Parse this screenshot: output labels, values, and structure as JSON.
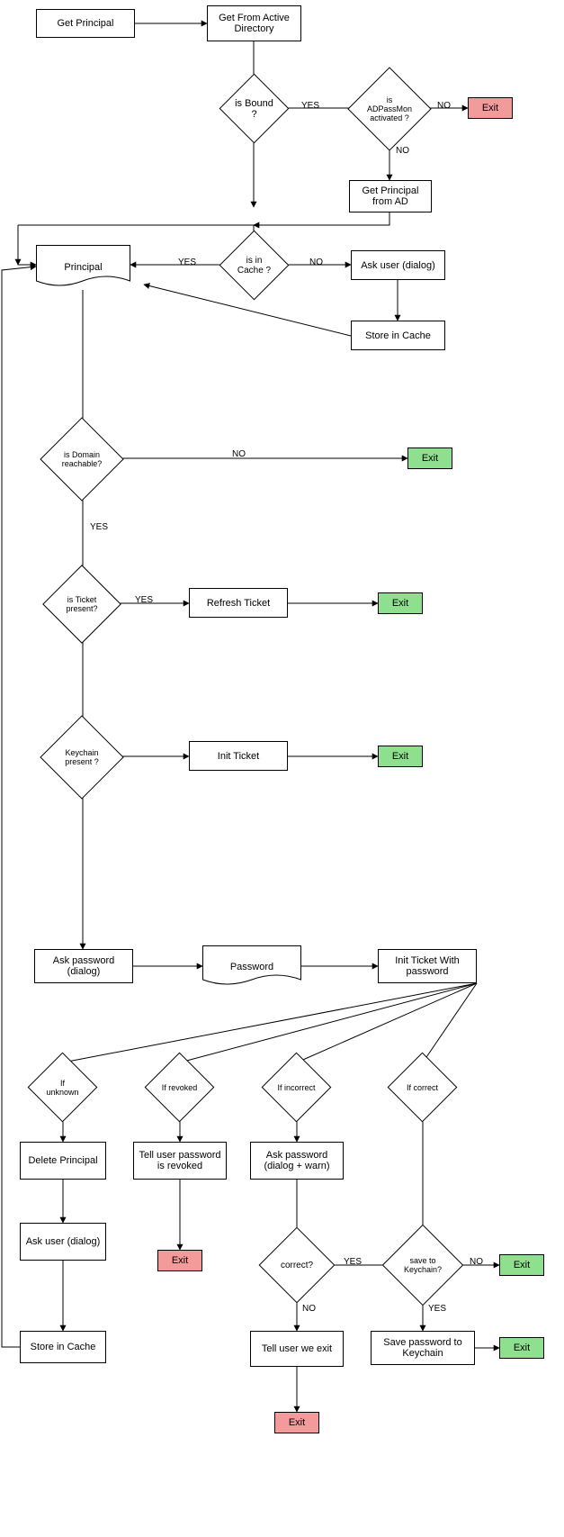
{
  "nodes": {
    "getPrincipal": "Get Principal",
    "getFromAD": "Get From Active Directory",
    "isBound": "is Bound ?",
    "isAdpassmon": "is ADPassMon activated ?",
    "exit1": "Exit",
    "getPrincAD": "Get Principal from AD",
    "principal": "Principal",
    "isInCache": "is in Cache ?",
    "askUser1": "Ask user (dialog)",
    "storeCache1": "Store in Cache",
    "isDomain": "is Domain reachable?",
    "exit2": "Exit",
    "isTicket": "is Ticket present?",
    "refresh": "Refresh Ticket",
    "exit3": "Exit",
    "keychain": "Keychain present ?",
    "initTicket": "Init Ticket",
    "exit4": "Exit",
    "askPwd": "Ask password (dialog)",
    "password": "Password",
    "initTicketPwd": "Init Ticket With password",
    "ifUnknown": "If unknown",
    "ifRevoked": "If revoked",
    "ifIncorrect": "If incorrect",
    "ifCorrect": "If correct",
    "deletePrinc": "Delete Principal",
    "tellRevoked": "Tell user password is revoked",
    "askPwdWarn": "Ask password (dialog + warn)",
    "exit5": "Exit",
    "askUser2": "Ask user (dialog)",
    "correct": "correct?",
    "saveKeychain": "save to Keychain?",
    "exit6": "Exit",
    "storeCache2": "Store in Cache",
    "tellExit": "Tell user we exit",
    "savePwdKey": "Save password to Keychain",
    "exit7": "Exit",
    "exit8": "Exit"
  },
  "labels": {
    "yes": "YES",
    "no": "NO"
  },
  "chart_data": {
    "type": "flowchart",
    "nodes": [
      {
        "id": "getPrincipal",
        "kind": "process",
        "label": "Get Principal"
      },
      {
        "id": "getFromAD",
        "kind": "process",
        "label": "Get From Active Directory"
      },
      {
        "id": "isBound",
        "kind": "decision",
        "label": "is Bound ?"
      },
      {
        "id": "isAdpassmon",
        "kind": "decision",
        "label": "is ADPassMon activated ?"
      },
      {
        "id": "exit1",
        "kind": "terminator",
        "label": "Exit",
        "color": "red"
      },
      {
        "id": "getPrincAD",
        "kind": "process",
        "label": "Get Principal from AD"
      },
      {
        "id": "principal",
        "kind": "document",
        "label": "Principal"
      },
      {
        "id": "isInCache",
        "kind": "decision",
        "label": "is in Cache ?"
      },
      {
        "id": "askUser1",
        "kind": "process",
        "label": "Ask user (dialog)"
      },
      {
        "id": "storeCache1",
        "kind": "process",
        "label": "Store in Cache"
      },
      {
        "id": "isDomain",
        "kind": "decision",
        "label": "is Domain reachable?"
      },
      {
        "id": "exit2",
        "kind": "terminator",
        "label": "Exit",
        "color": "green"
      },
      {
        "id": "isTicket",
        "kind": "decision",
        "label": "is Ticket present?"
      },
      {
        "id": "refresh",
        "kind": "process",
        "label": "Refresh Ticket"
      },
      {
        "id": "exit3",
        "kind": "terminator",
        "label": "Exit",
        "color": "green"
      },
      {
        "id": "keychain",
        "kind": "decision",
        "label": "Keychain present ?"
      },
      {
        "id": "initTicket",
        "kind": "process",
        "label": "Init Ticket"
      },
      {
        "id": "exit4",
        "kind": "terminator",
        "label": "Exit",
        "color": "green"
      },
      {
        "id": "askPwd",
        "kind": "process",
        "label": "Ask password (dialog)"
      },
      {
        "id": "password",
        "kind": "document",
        "label": "Password"
      },
      {
        "id": "initTicketPwd",
        "kind": "process",
        "label": "Init Ticket With password"
      },
      {
        "id": "ifUnknown",
        "kind": "decision",
        "label": "If unknown"
      },
      {
        "id": "ifRevoked",
        "kind": "decision",
        "label": "If revoked"
      },
      {
        "id": "ifIncorrect",
        "kind": "decision",
        "label": "If incorrect"
      },
      {
        "id": "ifCorrect",
        "kind": "decision",
        "label": "If correct"
      },
      {
        "id": "deletePrinc",
        "kind": "process",
        "label": "Delete Principal"
      },
      {
        "id": "tellRevoked",
        "kind": "process",
        "label": "Tell user password is revoked"
      },
      {
        "id": "askPwdWarn",
        "kind": "process",
        "label": "Ask password (dialog + warn)"
      },
      {
        "id": "exit5",
        "kind": "terminator",
        "label": "Exit",
        "color": "red"
      },
      {
        "id": "askUser2",
        "kind": "process",
        "label": "Ask user (dialog)"
      },
      {
        "id": "correct",
        "kind": "decision",
        "label": "correct?"
      },
      {
        "id": "saveKeychain",
        "kind": "decision",
        "label": "save to Keychain?"
      },
      {
        "id": "exit6",
        "kind": "terminator",
        "label": "Exit",
        "color": "green"
      },
      {
        "id": "storeCache2",
        "kind": "process",
        "label": "Store in Cache"
      },
      {
        "id": "tellExit",
        "kind": "process",
        "label": "Tell user we exit"
      },
      {
        "id": "savePwdKey",
        "kind": "process",
        "label": "Save password to Keychain"
      },
      {
        "id": "exit7",
        "kind": "terminator",
        "label": "Exit",
        "color": "green"
      },
      {
        "id": "exit8",
        "kind": "terminator",
        "label": "Exit",
        "color": "red"
      }
    ],
    "edges": [
      {
        "from": "getPrincipal",
        "to": "getFromAD"
      },
      {
        "from": "getFromAD",
        "to": "isBound"
      },
      {
        "from": "isBound",
        "to": "isAdpassmon",
        "label": "YES"
      },
      {
        "from": "isAdpassmon",
        "to": "exit1",
        "label": "NO"
      },
      {
        "from": "isAdpassmon",
        "to": "getPrincAD",
        "label": "NO"
      },
      {
        "from": "isBound",
        "to": "isInCache",
        "via": "down",
        "label": ""
      },
      {
        "from": "getPrincAD",
        "to": "isInCache",
        "via": "down-left"
      },
      {
        "from": "isInCache",
        "to": "principal",
        "label": "YES"
      },
      {
        "from": "isInCache",
        "to": "askUser1",
        "label": "NO"
      },
      {
        "from": "askUser1",
        "to": "storeCache1"
      },
      {
        "from": "storeCache1",
        "to": "principal"
      },
      {
        "from": "principal",
        "to": "isDomain"
      },
      {
        "from": "isDomain",
        "to": "exit2",
        "label": "NO"
      },
      {
        "from": "isDomain",
        "to": "isTicket",
        "label": "YES"
      },
      {
        "from": "isTicket",
        "to": "refresh",
        "label": "YES"
      },
      {
        "from": "refresh",
        "to": "exit3"
      },
      {
        "from": "isTicket",
        "to": "keychain"
      },
      {
        "from": "keychain",
        "to": "initTicket"
      },
      {
        "from": "initTicket",
        "to": "exit4"
      },
      {
        "from": "keychain",
        "to": "askPwd"
      },
      {
        "from": "askPwd",
        "to": "password"
      },
      {
        "from": "password",
        "to": "initTicketPwd"
      },
      {
        "from": "initTicketPwd",
        "to": "ifUnknown"
      },
      {
        "from": "initTicketPwd",
        "to": "ifRevoked"
      },
      {
        "from": "initTicketPwd",
        "to": "ifIncorrect"
      },
      {
        "from": "initTicketPwd",
        "to": "ifCorrect"
      },
      {
        "from": "ifUnknown",
        "to": "deletePrinc"
      },
      {
        "from": "ifRevoked",
        "to": "tellRevoked"
      },
      {
        "from": "ifIncorrect",
        "to": "askPwdWarn"
      },
      {
        "from": "ifCorrect",
        "to": "saveKeychain"
      },
      {
        "from": "deletePrinc",
        "to": "askUser2"
      },
      {
        "from": "tellRevoked",
        "to": "exit5"
      },
      {
        "from": "askPwdWarn",
        "to": "correct"
      },
      {
        "from": "askUser2",
        "to": "storeCache2"
      },
      {
        "from": "storeCache2",
        "to": "principal"
      },
      {
        "from": "correct",
        "to": "saveKeychain",
        "label": "YES"
      },
      {
        "from": "correct",
        "to": "tellExit",
        "label": "NO"
      },
      {
        "from": "saveKeychain",
        "to": "exit6",
        "label": "NO"
      },
      {
        "from": "saveKeychain",
        "to": "savePwdKey",
        "label": "YES"
      },
      {
        "from": "savePwdKey",
        "to": "exit7"
      },
      {
        "from": "tellExit",
        "to": "exit8"
      }
    ]
  }
}
